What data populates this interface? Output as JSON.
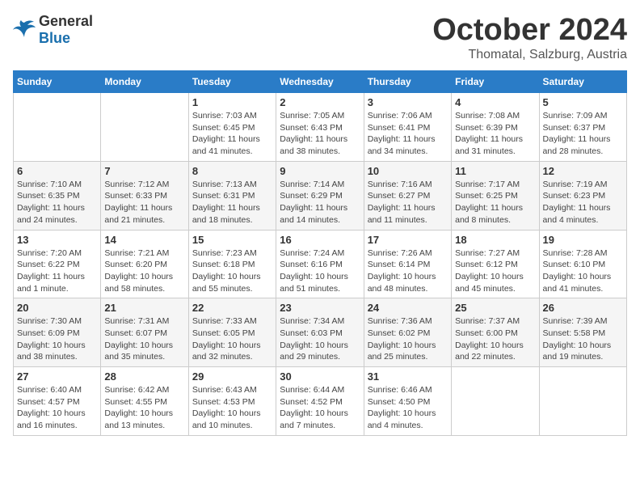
{
  "header": {
    "logo": {
      "general": "General",
      "blue": "Blue"
    },
    "title": "October 2024",
    "location": "Thomatal, Salzburg, Austria"
  },
  "calendar": {
    "weekdays": [
      "Sunday",
      "Monday",
      "Tuesday",
      "Wednesday",
      "Thursday",
      "Friday",
      "Saturday"
    ],
    "weeks": [
      [
        {
          "day": "",
          "info": ""
        },
        {
          "day": "",
          "info": ""
        },
        {
          "day": "1",
          "info": "Sunrise: 7:03 AM\nSunset: 6:45 PM\nDaylight: 11 hours and 41 minutes."
        },
        {
          "day": "2",
          "info": "Sunrise: 7:05 AM\nSunset: 6:43 PM\nDaylight: 11 hours and 38 minutes."
        },
        {
          "day": "3",
          "info": "Sunrise: 7:06 AM\nSunset: 6:41 PM\nDaylight: 11 hours and 34 minutes."
        },
        {
          "day": "4",
          "info": "Sunrise: 7:08 AM\nSunset: 6:39 PM\nDaylight: 11 hours and 31 minutes."
        },
        {
          "day": "5",
          "info": "Sunrise: 7:09 AM\nSunset: 6:37 PM\nDaylight: 11 hours and 28 minutes."
        }
      ],
      [
        {
          "day": "6",
          "info": "Sunrise: 7:10 AM\nSunset: 6:35 PM\nDaylight: 11 hours and 24 minutes."
        },
        {
          "day": "7",
          "info": "Sunrise: 7:12 AM\nSunset: 6:33 PM\nDaylight: 11 hours and 21 minutes."
        },
        {
          "day": "8",
          "info": "Sunrise: 7:13 AM\nSunset: 6:31 PM\nDaylight: 11 hours and 18 minutes."
        },
        {
          "day": "9",
          "info": "Sunrise: 7:14 AM\nSunset: 6:29 PM\nDaylight: 11 hours and 14 minutes."
        },
        {
          "day": "10",
          "info": "Sunrise: 7:16 AM\nSunset: 6:27 PM\nDaylight: 11 hours and 11 minutes."
        },
        {
          "day": "11",
          "info": "Sunrise: 7:17 AM\nSunset: 6:25 PM\nDaylight: 11 hours and 8 minutes."
        },
        {
          "day": "12",
          "info": "Sunrise: 7:19 AM\nSunset: 6:23 PM\nDaylight: 11 hours and 4 minutes."
        }
      ],
      [
        {
          "day": "13",
          "info": "Sunrise: 7:20 AM\nSunset: 6:22 PM\nDaylight: 11 hours and 1 minute."
        },
        {
          "day": "14",
          "info": "Sunrise: 7:21 AM\nSunset: 6:20 PM\nDaylight: 10 hours and 58 minutes."
        },
        {
          "day": "15",
          "info": "Sunrise: 7:23 AM\nSunset: 6:18 PM\nDaylight: 10 hours and 55 minutes."
        },
        {
          "day": "16",
          "info": "Sunrise: 7:24 AM\nSunset: 6:16 PM\nDaylight: 10 hours and 51 minutes."
        },
        {
          "day": "17",
          "info": "Sunrise: 7:26 AM\nSunset: 6:14 PM\nDaylight: 10 hours and 48 minutes."
        },
        {
          "day": "18",
          "info": "Sunrise: 7:27 AM\nSunset: 6:12 PM\nDaylight: 10 hours and 45 minutes."
        },
        {
          "day": "19",
          "info": "Sunrise: 7:28 AM\nSunset: 6:10 PM\nDaylight: 10 hours and 41 minutes."
        }
      ],
      [
        {
          "day": "20",
          "info": "Sunrise: 7:30 AM\nSunset: 6:09 PM\nDaylight: 10 hours and 38 minutes."
        },
        {
          "day": "21",
          "info": "Sunrise: 7:31 AM\nSunset: 6:07 PM\nDaylight: 10 hours and 35 minutes."
        },
        {
          "day": "22",
          "info": "Sunrise: 7:33 AM\nSunset: 6:05 PM\nDaylight: 10 hours and 32 minutes."
        },
        {
          "day": "23",
          "info": "Sunrise: 7:34 AM\nSunset: 6:03 PM\nDaylight: 10 hours and 29 minutes."
        },
        {
          "day": "24",
          "info": "Sunrise: 7:36 AM\nSunset: 6:02 PM\nDaylight: 10 hours and 25 minutes."
        },
        {
          "day": "25",
          "info": "Sunrise: 7:37 AM\nSunset: 6:00 PM\nDaylight: 10 hours and 22 minutes."
        },
        {
          "day": "26",
          "info": "Sunrise: 7:39 AM\nSunset: 5:58 PM\nDaylight: 10 hours and 19 minutes."
        }
      ],
      [
        {
          "day": "27",
          "info": "Sunrise: 6:40 AM\nSunset: 4:57 PM\nDaylight: 10 hours and 16 minutes."
        },
        {
          "day": "28",
          "info": "Sunrise: 6:42 AM\nSunset: 4:55 PM\nDaylight: 10 hours and 13 minutes."
        },
        {
          "day": "29",
          "info": "Sunrise: 6:43 AM\nSunset: 4:53 PM\nDaylight: 10 hours and 10 minutes."
        },
        {
          "day": "30",
          "info": "Sunrise: 6:44 AM\nSunset: 4:52 PM\nDaylight: 10 hours and 7 minutes."
        },
        {
          "day": "31",
          "info": "Sunrise: 6:46 AM\nSunset: 4:50 PM\nDaylight: 10 hours and 4 minutes."
        },
        {
          "day": "",
          "info": ""
        },
        {
          "day": "",
          "info": ""
        }
      ]
    ]
  }
}
